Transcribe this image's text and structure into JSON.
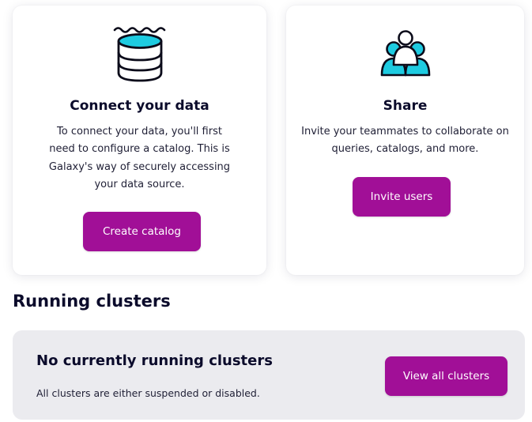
{
  "connect_card": {
    "icon": "database-icon",
    "title": "Connect your data",
    "description": "To connect your data, you'll first need to configure a catalog. This is Galaxy's way of securely accessing your data source.",
    "button_label": "Create catalog"
  },
  "share_card": {
    "icon": "users-icon",
    "title": "Share",
    "description": "Invite your teammates to collaborate on queries, catalogs, and more.",
    "button_label": "Invite users"
  },
  "running_clusters": {
    "section_title": "Running clusters",
    "empty_title": "No currently running clusters",
    "empty_description": "All clusters are either suspended or disabled.",
    "button_label": "View all clusters"
  },
  "colors": {
    "accent": "#a10f97",
    "icon_fill": "#1ecbe1",
    "panel_bg": "#ebebef",
    "text": "#0b0b2b"
  }
}
